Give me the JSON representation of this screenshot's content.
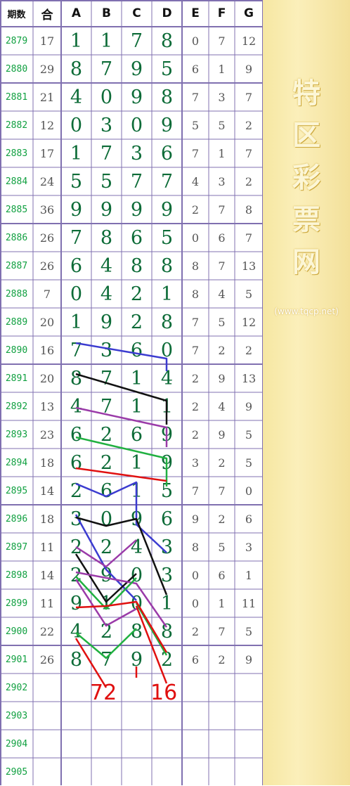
{
  "headers": [
    "期数",
    "合",
    "A",
    "B",
    "C",
    "D",
    "E",
    "F",
    "G"
  ],
  "rows": [
    {
      "period": "2879",
      "sum": "17",
      "a": "1",
      "b": "1",
      "c": "7",
      "d": "8",
      "e": "0",
      "f": "7",
      "g": "12"
    },
    {
      "period": "2880",
      "sum": "29",
      "a": "8",
      "b": "7",
      "c": "9",
      "d": "5",
      "e": "6",
      "f": "1",
      "g": "9"
    },
    {
      "period": "2881",
      "sum": "21",
      "a": "4",
      "b": "0",
      "c": "9",
      "d": "8",
      "e": "7",
      "f": "3",
      "g": "7"
    },
    {
      "period": "2882",
      "sum": "12",
      "a": "0",
      "b": "3",
      "c": "0",
      "d": "9",
      "e": "5",
      "f": "5",
      "g": "2"
    },
    {
      "period": "2883",
      "sum": "17",
      "a": "1",
      "b": "7",
      "c": "3",
      "d": "6",
      "e": "7",
      "f": "1",
      "g": "7"
    },
    {
      "period": "2884",
      "sum": "24",
      "a": "5",
      "b": "5",
      "c": "7",
      "d": "7",
      "e": "4",
      "f": "3",
      "g": "2"
    },
    {
      "period": "2885",
      "sum": "36",
      "a": "9",
      "b": "9",
      "c": "9",
      "d": "9",
      "e": "2",
      "f": "7",
      "g": "8"
    },
    {
      "period": "2886",
      "sum": "26",
      "a": "7",
      "b": "8",
      "c": "6",
      "d": "5",
      "e": "0",
      "f": "6",
      "g": "7"
    },
    {
      "period": "2887",
      "sum": "26",
      "a": "6",
      "b": "4",
      "c": "8",
      "d": "8",
      "e": "8",
      "f": "7",
      "g": "13"
    },
    {
      "period": "2888",
      "sum": "7",
      "a": "0",
      "b": "4",
      "c": "2",
      "d": "1",
      "e": "8",
      "f": "4",
      "g": "5"
    },
    {
      "period": "2889",
      "sum": "20",
      "a": "1",
      "b": "9",
      "c": "2",
      "d": "8",
      "e": "7",
      "f": "5",
      "g": "12"
    },
    {
      "period": "2890",
      "sum": "16",
      "a": "7",
      "b": "3",
      "c": "6",
      "d": "0",
      "e": "7",
      "f": "2",
      "g": "2"
    },
    {
      "period": "2891",
      "sum": "20",
      "a": "8",
      "b": "7",
      "c": "1",
      "d": "4",
      "e": "2",
      "f": "9",
      "g": "13"
    },
    {
      "period": "2892",
      "sum": "13",
      "a": "4",
      "b": "7",
      "c": "1",
      "d": "1",
      "e": "2",
      "f": "4",
      "g": "9"
    },
    {
      "period": "2893",
      "sum": "23",
      "a": "6",
      "b": "2",
      "c": "6",
      "d": "9",
      "e": "2",
      "f": "9",
      "g": "5"
    },
    {
      "period": "2894",
      "sum": "18",
      "a": "6",
      "b": "2",
      "c": "1",
      "d": "9",
      "e": "3",
      "f": "2",
      "g": "5"
    },
    {
      "period": "2895",
      "sum": "14",
      "a": "2",
      "b": "6",
      "c": "1",
      "d": "5",
      "e": "7",
      "f": "7",
      "g": "0"
    },
    {
      "period": "2896",
      "sum": "18",
      "a": "3",
      "b": "0",
      "c": "9",
      "d": "6",
      "e": "9",
      "f": "2",
      "g": "6"
    },
    {
      "period": "2897",
      "sum": "11",
      "a": "2",
      "b": "2",
      "c": "4",
      "d": "3",
      "e": "8",
      "f": "5",
      "g": "3"
    },
    {
      "period": "2898",
      "sum": "14",
      "a": "2",
      "b": "9",
      "c": "0",
      "d": "3",
      "e": "0",
      "f": "6",
      "g": "1"
    },
    {
      "period": "2899",
      "sum": "11",
      "a": "9",
      "b": "1",
      "c": "0",
      "d": "1",
      "e": "0",
      "f": "1",
      "g": "11"
    },
    {
      "period": "2900",
      "sum": "22",
      "a": "4",
      "b": "2",
      "c": "8",
      "d": "8",
      "e": "2",
      "f": "7",
      "g": "5"
    },
    {
      "period": "2901",
      "sum": "26",
      "a": "8",
      "b": "7",
      "c": "9",
      "d": "2",
      "e": "6",
      "f": "2",
      "g": "9"
    },
    {
      "period": "2902",
      "sum": "",
      "a": "",
      "b": "",
      "c": "",
      "d": "",
      "e": "",
      "f": "",
      "g": ""
    },
    {
      "period": "2903",
      "sum": "",
      "a": "",
      "b": "",
      "c": "",
      "d": "",
      "e": "",
      "f": "",
      "g": ""
    },
    {
      "period": "2904",
      "sum": "",
      "a": "",
      "b": "",
      "c": "",
      "d": "",
      "e": "",
      "f": "",
      "g": ""
    },
    {
      "period": "2905",
      "sum": "",
      "a": "",
      "b": "",
      "c": "",
      "d": "",
      "e": "",
      "f": "",
      "g": ""
    }
  ],
  "annotations": {
    "left_number": "72",
    "right_number": "16"
  },
  "banner": {
    "chars": [
      "特",
      "区",
      "彩",
      "票",
      "网"
    ],
    "url": "(www.tqcp.net)"
  },
  "colors": {
    "period": "#10a040",
    "big_digits": "#0c6b37",
    "small_digits": "#555555",
    "grid_line": "#8070b0",
    "annotation": "#e01010",
    "banner_bg": "#f6e7a2"
  },
  "line_colors": [
    "#3b3bd0",
    "#111111",
    "#9a3aa8",
    "#20b040",
    "#e01010"
  ]
}
